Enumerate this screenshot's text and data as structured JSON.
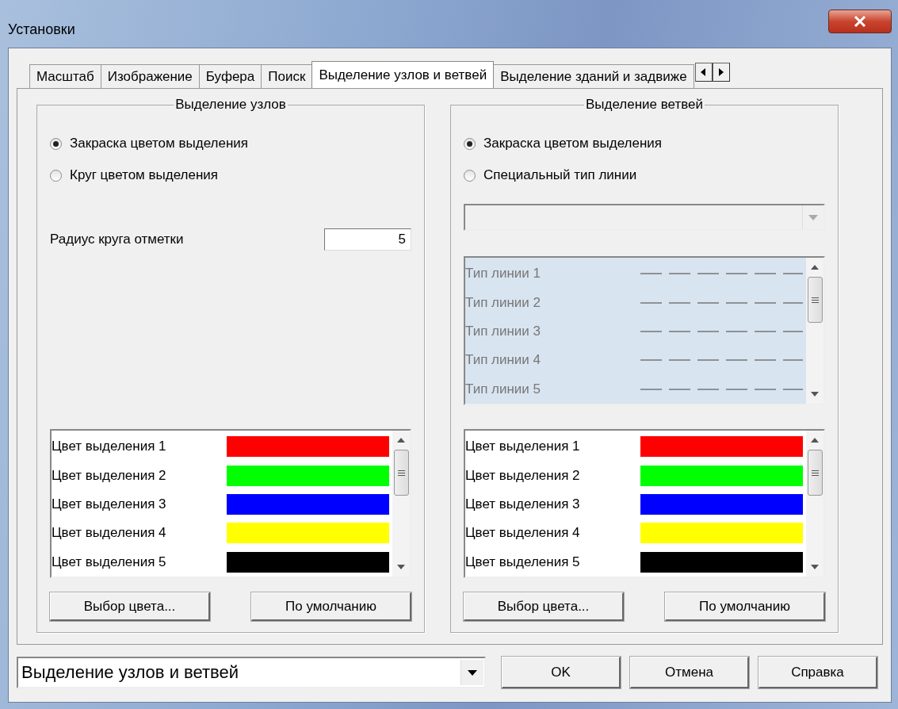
{
  "window": {
    "title": "Установки"
  },
  "tabs": [
    {
      "label": "Масштаб",
      "selected": false
    },
    {
      "label": "Изображение",
      "selected": false
    },
    {
      "label": "Буфера",
      "selected": false
    },
    {
      "label": "Поиск",
      "selected": false
    },
    {
      "label": "Выделение узлов и ветвей",
      "selected": true
    },
    {
      "label": "Выделение зданий и задвиже",
      "selected": false
    }
  ],
  "node_group": {
    "title": "Выделение узлов",
    "options": [
      {
        "label": "Закраска цветом выделения",
        "selected": true
      },
      {
        "label": "Круг цветом выделения",
        "selected": false
      }
    ],
    "radius": {
      "label": "Радиус круга отметки",
      "value": "5"
    },
    "colors": [
      {
        "label": "Цвет выделения 1",
        "color": "#ff0000"
      },
      {
        "label": "Цвет выделения 2",
        "color": "#00ff00"
      },
      {
        "label": "Цвет выделения 3",
        "color": "#0000ff"
      },
      {
        "label": "Цвет выделения 4",
        "color": "#ffff00"
      },
      {
        "label": "Цвет выделения 5",
        "color": "#000000"
      }
    ],
    "buttons": [
      "Выбор цвета...",
      "По умолчанию"
    ]
  },
  "branch_group": {
    "title": "Выделение ветвей",
    "options": [
      {
        "label": "Закраска цветом выделения",
        "selected": true
      },
      {
        "label": "Специальный тип линии",
        "selected": false
      }
    ],
    "line_types": {
      "disabled": true,
      "items": [
        {
          "label": "Тип линии 1"
        },
        {
          "label": "Тип линии 2"
        },
        {
          "label": "Тип линии 3"
        },
        {
          "label": "Тип линии 4"
        },
        {
          "label": "Тип линии 5"
        }
      ]
    },
    "colors": [
      {
        "label": "Цвет выделения 1",
        "color": "#ff0000"
      },
      {
        "label": "Цвет выделения 2",
        "color": "#00ff00"
      },
      {
        "label": "Цвет выделения 3",
        "color": "#0000ff"
      },
      {
        "label": "Цвет выделения 4",
        "color": "#ffff00"
      },
      {
        "label": "Цвет выделения 5",
        "color": "#000000"
      }
    ],
    "buttons": [
      "Выбор цвета...",
      "По умолчанию"
    ]
  },
  "footer": {
    "page_select": {
      "value": "Выделение узлов и ветвей"
    },
    "buttons": [
      "OK",
      "Отмена",
      "Справка"
    ]
  }
}
